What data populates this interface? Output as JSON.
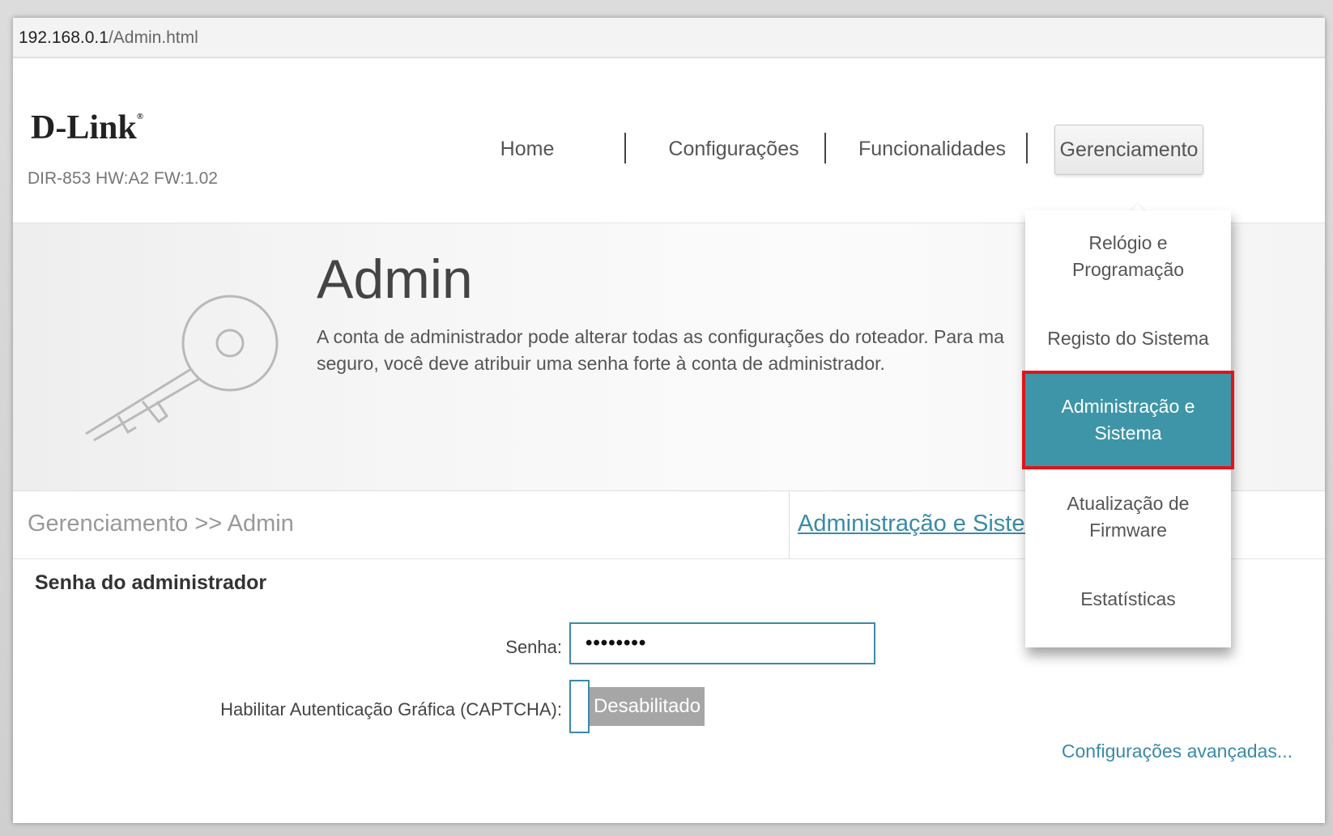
{
  "browser": {
    "url_host": "192.168.0.1",
    "url_path": "/Admin.html"
  },
  "header": {
    "logo": "D-Link",
    "logo_mark": "®",
    "model": "DIR-853 HW:A2 FW:1.02",
    "nav": [
      {
        "label": "Home"
      },
      {
        "label": "Configurações"
      },
      {
        "label": "Funcionalidades"
      },
      {
        "label": "Gerenciamento"
      }
    ]
  },
  "dropdown": {
    "items": [
      {
        "line1": "Relógio e",
        "line2": "Programação"
      },
      {
        "line1": "Registo do Sistema",
        "line2": ""
      },
      {
        "line1": "Administração e",
        "line2": "Sistema"
      },
      {
        "line1": "Atualização de",
        "line2": "Firmware"
      },
      {
        "line1": "Estatísticas",
        "line2": ""
      }
    ]
  },
  "banner": {
    "title": "Admin",
    "description_line1": "A conta de administrador pode alterar todas as configurações do roteador. Para ma",
    "description_line2": "seguro, você deve atribuir uma senha forte à conta de administrador."
  },
  "breadcrumb": {
    "path": "Gerenciamento >> Admin",
    "link": "Administração e Sistema"
  },
  "form": {
    "section_title": "Senha do administrador",
    "password_label": "Senha:",
    "password_value": "••••••••",
    "captcha_label": "Habilitar Autenticação Gráfica (CAPTCHA):",
    "captcha_state": "Desabilitado",
    "advanced_link": "Configurações avançadas..."
  },
  "colors": {
    "accent": "#3e95a8",
    "link": "#3a8aa8",
    "highlight_border": "#e0141c",
    "toggle_off": "#a6a6a6"
  }
}
